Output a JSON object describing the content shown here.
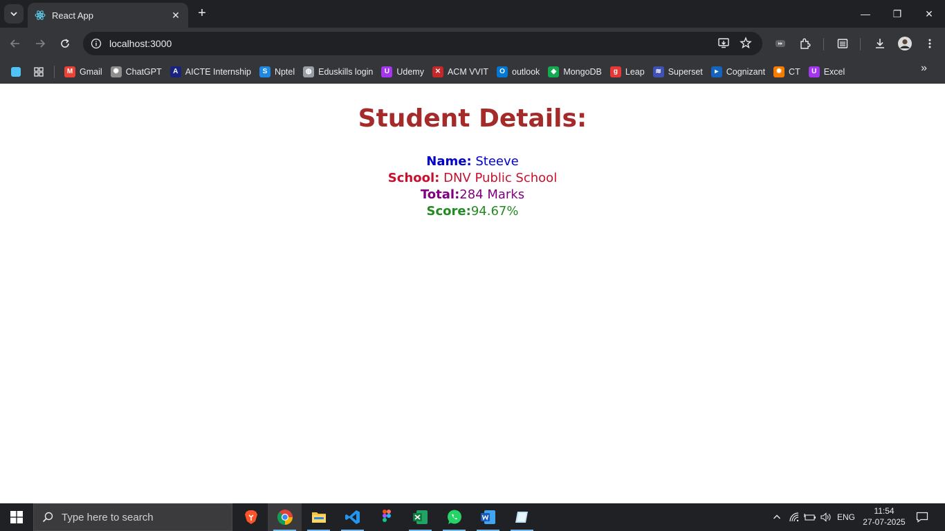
{
  "browser": {
    "tab_title": "React App",
    "tab_close": "✕",
    "new_tab": "+",
    "url": "localhost:3000",
    "minimize": "—",
    "maximize": "❐",
    "close": "✕"
  },
  "bookmarks": [
    {
      "label": "Gmail",
      "icon": "gmail-icon",
      "color": "#ea4335",
      "glyph": "M"
    },
    {
      "label": "ChatGPT",
      "icon": "chatgpt-icon",
      "color": "#8e8e8e",
      "glyph": "✺"
    },
    {
      "label": "AICTE Internship",
      "icon": "aicte-icon",
      "color": "#1a237e",
      "glyph": "A"
    },
    {
      "label": "Nptel",
      "icon": "nptel-icon",
      "color": "#1e88e5",
      "glyph": "S"
    },
    {
      "label": "Eduskills login",
      "icon": "globe-icon",
      "color": "#9aa0a6",
      "glyph": "◍"
    },
    {
      "label": "Udemy",
      "icon": "udemy-icon",
      "color": "#a435f0",
      "glyph": "U"
    },
    {
      "label": "ACM VVIT",
      "icon": "acm-icon",
      "color": "#c62828",
      "glyph": "✕"
    },
    {
      "label": "outlook",
      "icon": "outlook-icon",
      "color": "#0078d4",
      "glyph": "O"
    },
    {
      "label": "MongoDB",
      "icon": "mongodb-icon",
      "color": "#13aa52",
      "glyph": "◆"
    },
    {
      "label": "Leap",
      "icon": "leap-icon",
      "color": "#e53935",
      "glyph": "g"
    },
    {
      "label": "Superset",
      "icon": "superset-icon",
      "color": "#3f51b5",
      "glyph": "≋"
    },
    {
      "label": "Cognizant",
      "icon": "cognizant-icon",
      "color": "#1565c0",
      "glyph": "▸"
    },
    {
      "label": "CT",
      "icon": "ct-icon",
      "color": "#f57c00",
      "glyph": "✹"
    },
    {
      "label": "Excel",
      "icon": "udemy-icon",
      "color": "#a435f0",
      "glyph": "U"
    }
  ],
  "page": {
    "heading": "Student Details:",
    "name_label": "Name:",
    "name_value": " Steeve",
    "school_label": "School:",
    "school_value": " DNV Public School",
    "total_label": "Total:",
    "total_value": "284 Marks",
    "score_label": "Score:",
    "score_value": "94.67%",
    "colors": {
      "heading": "#a52a2a",
      "name": "#0000cd",
      "school": "#c8102e",
      "total": "#800080",
      "score": "#228b22"
    }
  },
  "taskbar": {
    "search_placeholder": "Type here to search",
    "language": "ENG",
    "time": "11:54",
    "date": "27-07-2025"
  }
}
